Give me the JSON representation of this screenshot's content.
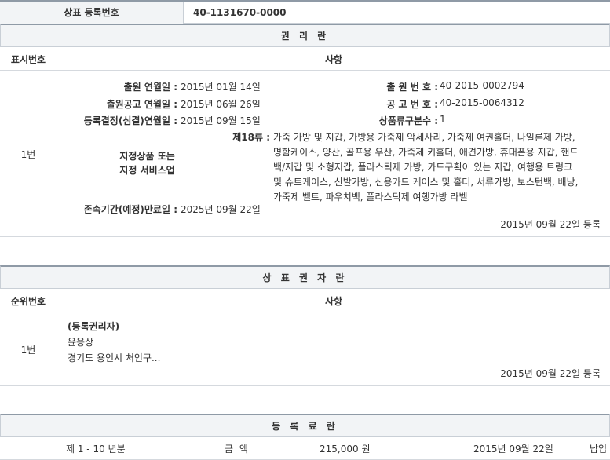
{
  "header": {
    "label": "상표 등록번호",
    "value": "40-1131670-0000"
  },
  "rights": {
    "title": "권 리 란",
    "col_num": "표시번호",
    "col_matter": "사항",
    "row_num": "1번",
    "app_date_label": "출원 연월일 :",
    "app_date": "2015년 01월 14일",
    "app_no_label": "출 원 번 호 :",
    "app_no": "40-2015-0002794",
    "pub_date_label": "출원공고 연월일 :",
    "pub_date": "2015년 06월 26일",
    "pub_no_label": "공 고 번 호 :",
    "pub_no": "40-2015-0064312",
    "reg_decision_label": "등록결정(심결)연월일 :",
    "reg_decision_date": "2015년 09월 15일",
    "class_count_label": "상품류구분수 :",
    "class_count": "1",
    "goods_label_1": "지정상품 또는",
    "goods_label_2": "지정 서비스업",
    "class_label": "제18류 :",
    "goods_lines": [
      "가죽 가방 및 지갑, 가방용 가죽제 악세사리, 가죽제 여권홀더, 나일론제 가방,",
      "명함케이스, 양산, 골프용 우산, 가죽제 키홀더, 애견가방, 휴대폰용 지갑, 핸드",
      "백/지갑 및 소형지갑, 플라스틱제 가방, 카드구획이 있는 지갑, 여행용 트렁크",
      "및 슈트케이스, 신발가방, 신용카드 케이스 및 홀더, 서류가방, 보스턴백, 배낭,",
      "가죽제 벨트, 파우치백, 플라스틱제 여행가방 라벨"
    ],
    "expiry_label": "존속기간(예정)만료일 :",
    "expiry_date": "2025년 09월 22일",
    "registered": "2015년 09월 22일 등록"
  },
  "owner": {
    "title": "상 표 권 자 란",
    "col_num": "순위번호",
    "col_matter": "사항",
    "row_num": "1번",
    "heading": "(등록권리자)",
    "name": "윤용상",
    "address": "경기도 용인시 처인구...",
    "registered": "2015년 09월 22일 등록"
  },
  "fee": {
    "title": "등 록 료 란",
    "period": "제 1 - 10 년분",
    "amount_label": "금 액",
    "amount": "215,000 원",
    "date": "2015년 09월 22일",
    "status": "납입"
  }
}
